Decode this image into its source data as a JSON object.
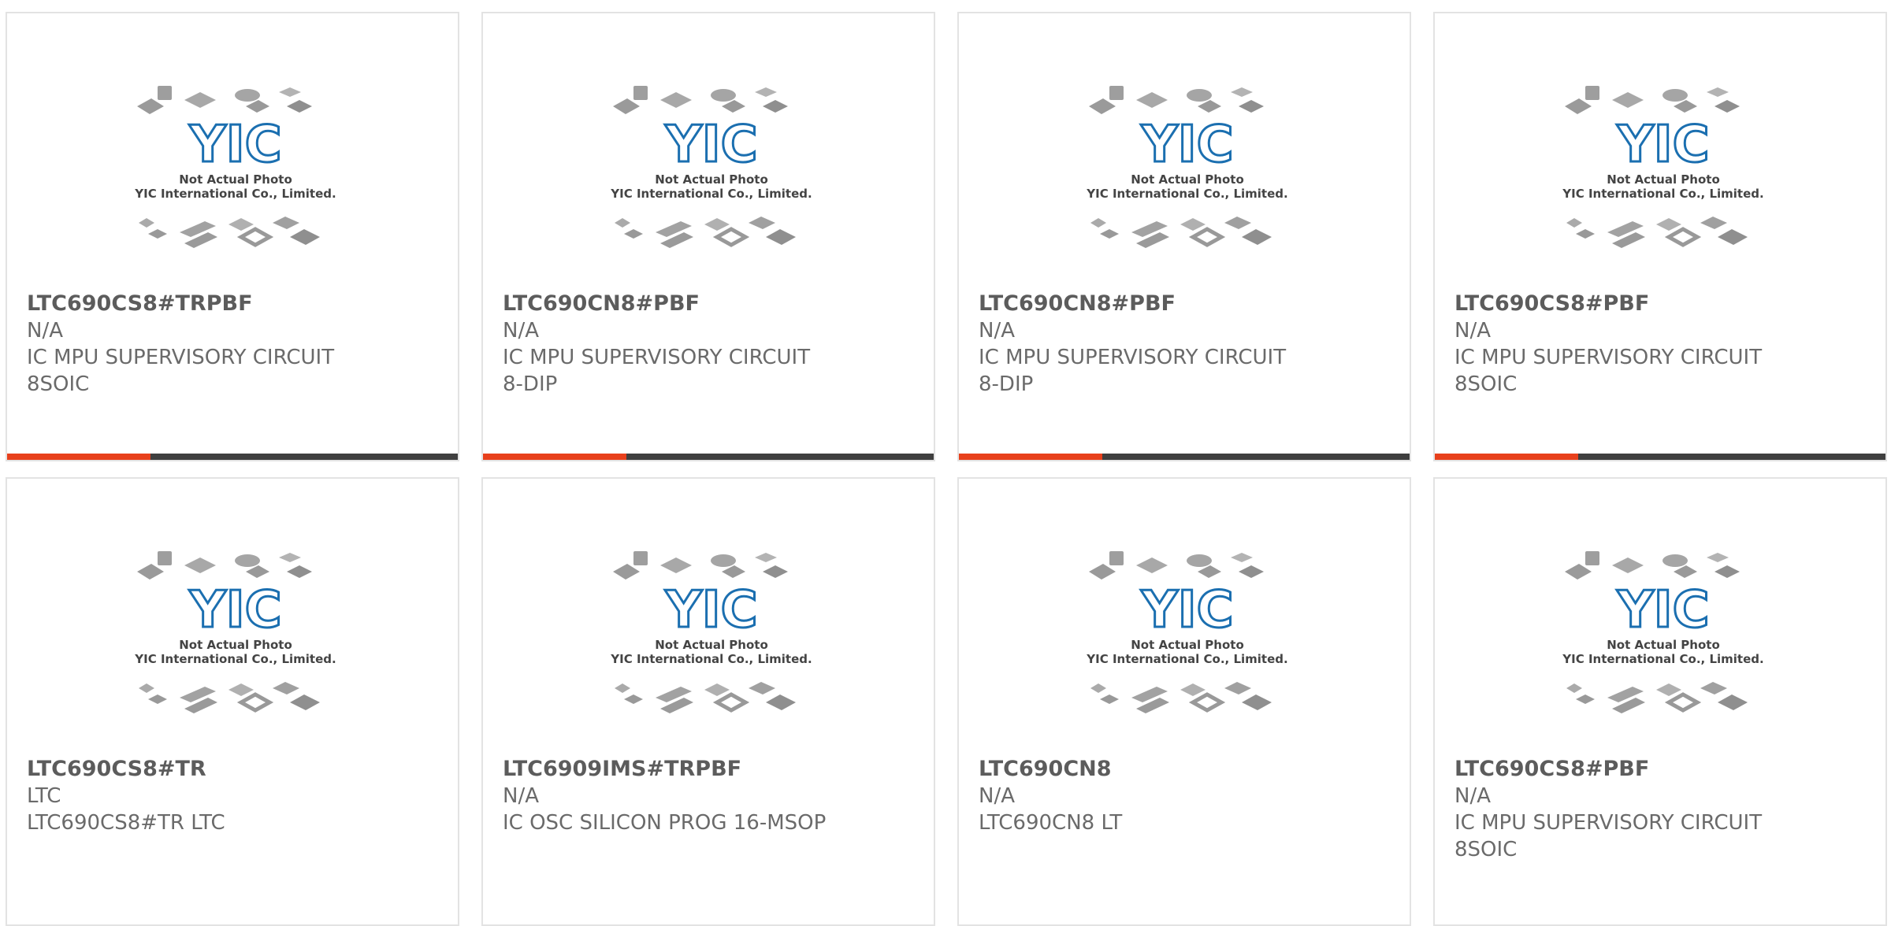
{
  "placeholder_image": {
    "line1": "Not Actual Photo",
    "line2": "YIC International Co., Limited.",
    "logo_text": "YIC"
  },
  "colors": {
    "accent": "#e8401c",
    "bar": "#3f3f3f",
    "logo": "#1b6fb0"
  },
  "products": [
    {
      "part": "LTC690CS8#TRPBF",
      "mfr": "N/A",
      "desc": [
        "IC MPU SUPERVISORY CIRCUIT",
        "8SOIC"
      ],
      "highlight": true
    },
    {
      "part": "LTC690CN8#PBF",
      "mfr": "N/A",
      "desc": [
        "IC MPU SUPERVISORY CIRCUIT",
        "8-DIP"
      ],
      "highlight": true
    },
    {
      "part": "LTC690CN8#PBF",
      "mfr": "N/A",
      "desc": [
        "IC MPU SUPERVISORY CIRCUIT",
        "8-DIP"
      ],
      "highlight": true
    },
    {
      "part": "LTC690CS8#PBF",
      "mfr": "N/A",
      "desc": [
        "IC MPU SUPERVISORY CIRCUIT",
        "8SOIC"
      ],
      "highlight": true
    },
    {
      "part": "LTC690CS8#TR",
      "mfr": "LTC",
      "desc": [
        "LTC690CS8#TR LTC",
        ""
      ],
      "highlight": false
    },
    {
      "part": "LTC6909IMS#TRPBF",
      "mfr": "N/A",
      "desc": [
        "IC OSC SILICON PROG 16-MSOP",
        ""
      ],
      "highlight": false
    },
    {
      "part": "LTC690CN8",
      "mfr": "N/A",
      "desc": [
        "LTC690CN8 LT",
        ""
      ],
      "highlight": false
    },
    {
      "part": "LTC690CS8#PBF",
      "mfr": "N/A",
      "desc": [
        "IC MPU SUPERVISORY CIRCUIT",
        "8SOIC"
      ],
      "highlight": false
    }
  ]
}
